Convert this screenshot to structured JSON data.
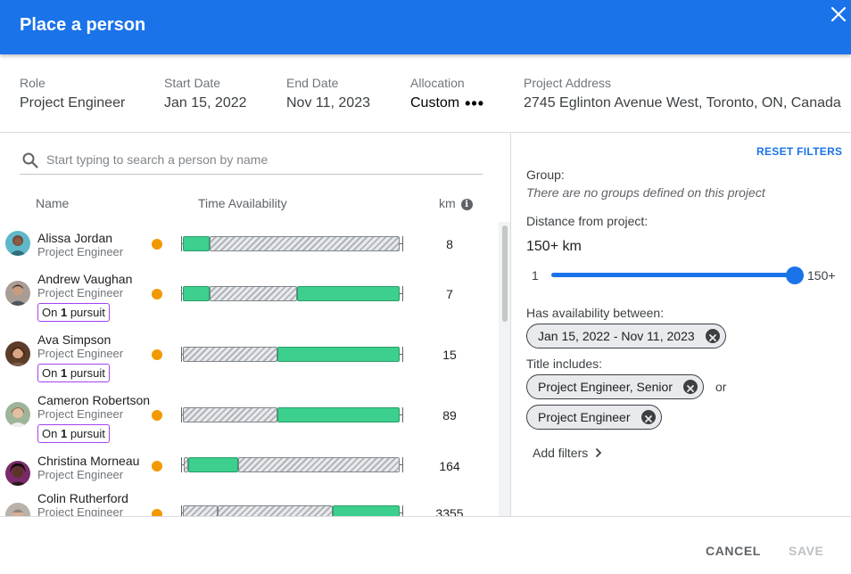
{
  "dialog": {
    "title": "Place a person"
  },
  "info": {
    "role": {
      "label": "Role",
      "value": "Project Engineer"
    },
    "start": {
      "label": "Start Date",
      "value": "Jan 15, 2022"
    },
    "end": {
      "label": "End Date",
      "value": "Nov 11, 2023"
    },
    "allocation": {
      "label": "Allocation",
      "value": "Custom",
      "more": "•••"
    },
    "address": {
      "label": "Project Address",
      "value": "2745 Eglinton Avenue West, Toronto, ON, Canada"
    }
  },
  "search": {
    "placeholder": "Start typing to search a person by name",
    "value": ""
  },
  "columns": {
    "name": "Name",
    "availability": "Time Availability",
    "km": "km"
  },
  "people": [
    {
      "name": "Alissa Jordan",
      "title": "Project Engineer",
      "pursuit": null,
      "km": "8",
      "status_color": "#f29900"
    },
    {
      "name": "Andrew Vaughan",
      "title": "Project Engineer",
      "pursuit": {
        "prefix": "On",
        "count": "1",
        "suffix": "pursuit"
      },
      "km": "7",
      "status_color": "#f29900"
    },
    {
      "name": "Ava Simpson",
      "title": "Project Engineer",
      "pursuit": {
        "prefix": "On",
        "count": "1",
        "suffix": "pursuit"
      },
      "km": "15",
      "status_color": "#f29900"
    },
    {
      "name": "Cameron Robertson",
      "title": "Project Engineer",
      "pursuit": {
        "prefix": "On",
        "count": "1",
        "suffix": "pursuit"
      },
      "km": "89",
      "status_color": "#f29900"
    },
    {
      "name": "Christina Morneau",
      "title": "Project Engineer",
      "pursuit": null,
      "km": "164",
      "status_color": "#f29900"
    },
    {
      "name": "Colin Rutherford",
      "title": "Project Engineer",
      "pursuit": null,
      "km": "3355",
      "status_color": "#f29900"
    }
  ],
  "filters": {
    "reset_label": "RESET FILTERS",
    "group_label": "Group:",
    "group_note": "There are no groups defined on this project",
    "distance_label": "Distance from project:",
    "distance_value": "150+ km",
    "slider_min": "1",
    "slider_max": "150+",
    "slider_level": 1.0,
    "availability_label": "Has availability between:",
    "availability_chip": "Jan 15, 2022 - Nov 11, 2023",
    "title_label": "Title includes:",
    "title_chips": [
      "Project Engineer, Senior",
      "Project Engineer"
    ],
    "or_text": "or",
    "add_filters": "Add filters"
  },
  "footer": {
    "cancel": "CANCEL",
    "save": "SAVE"
  },
  "colors": {
    "accent": "#1a73e8",
    "available": "#3ccf8e",
    "status": "#f29900",
    "pursuit_border": "#a142f4"
  }
}
